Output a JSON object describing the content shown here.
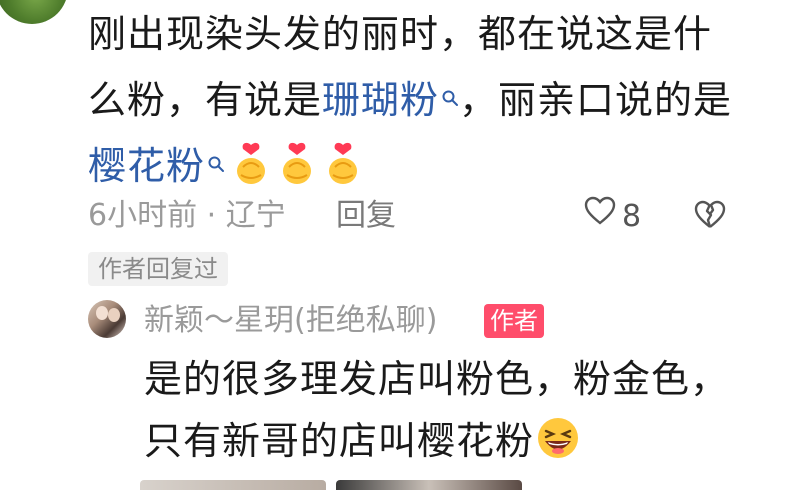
{
  "comment": {
    "text_part1": "刚出现染头发的丽时，都在说这是什",
    "text_part2": "么粉，有说是",
    "link1": "珊瑚粉",
    "text_part3": "，丽亲口说的是",
    "link2": "樱花粉",
    "emoji_count": 3,
    "time_location": "6小时前 · 辽宁",
    "reply_label": "回复",
    "like_count": "8",
    "author_replied_label": "作者回复过"
  },
  "reply": {
    "name": "新颖～星玥(拒绝私聊)",
    "author_tag": "作者",
    "line1": "是的很多理发店叫粉色，粉金色，",
    "line2": "只有新哥的店叫樱花粉"
  },
  "colors": {
    "link": "#2f5da8",
    "author_tag_bg": "#ff4d6b",
    "meta_gray": "#9a9a9a"
  }
}
